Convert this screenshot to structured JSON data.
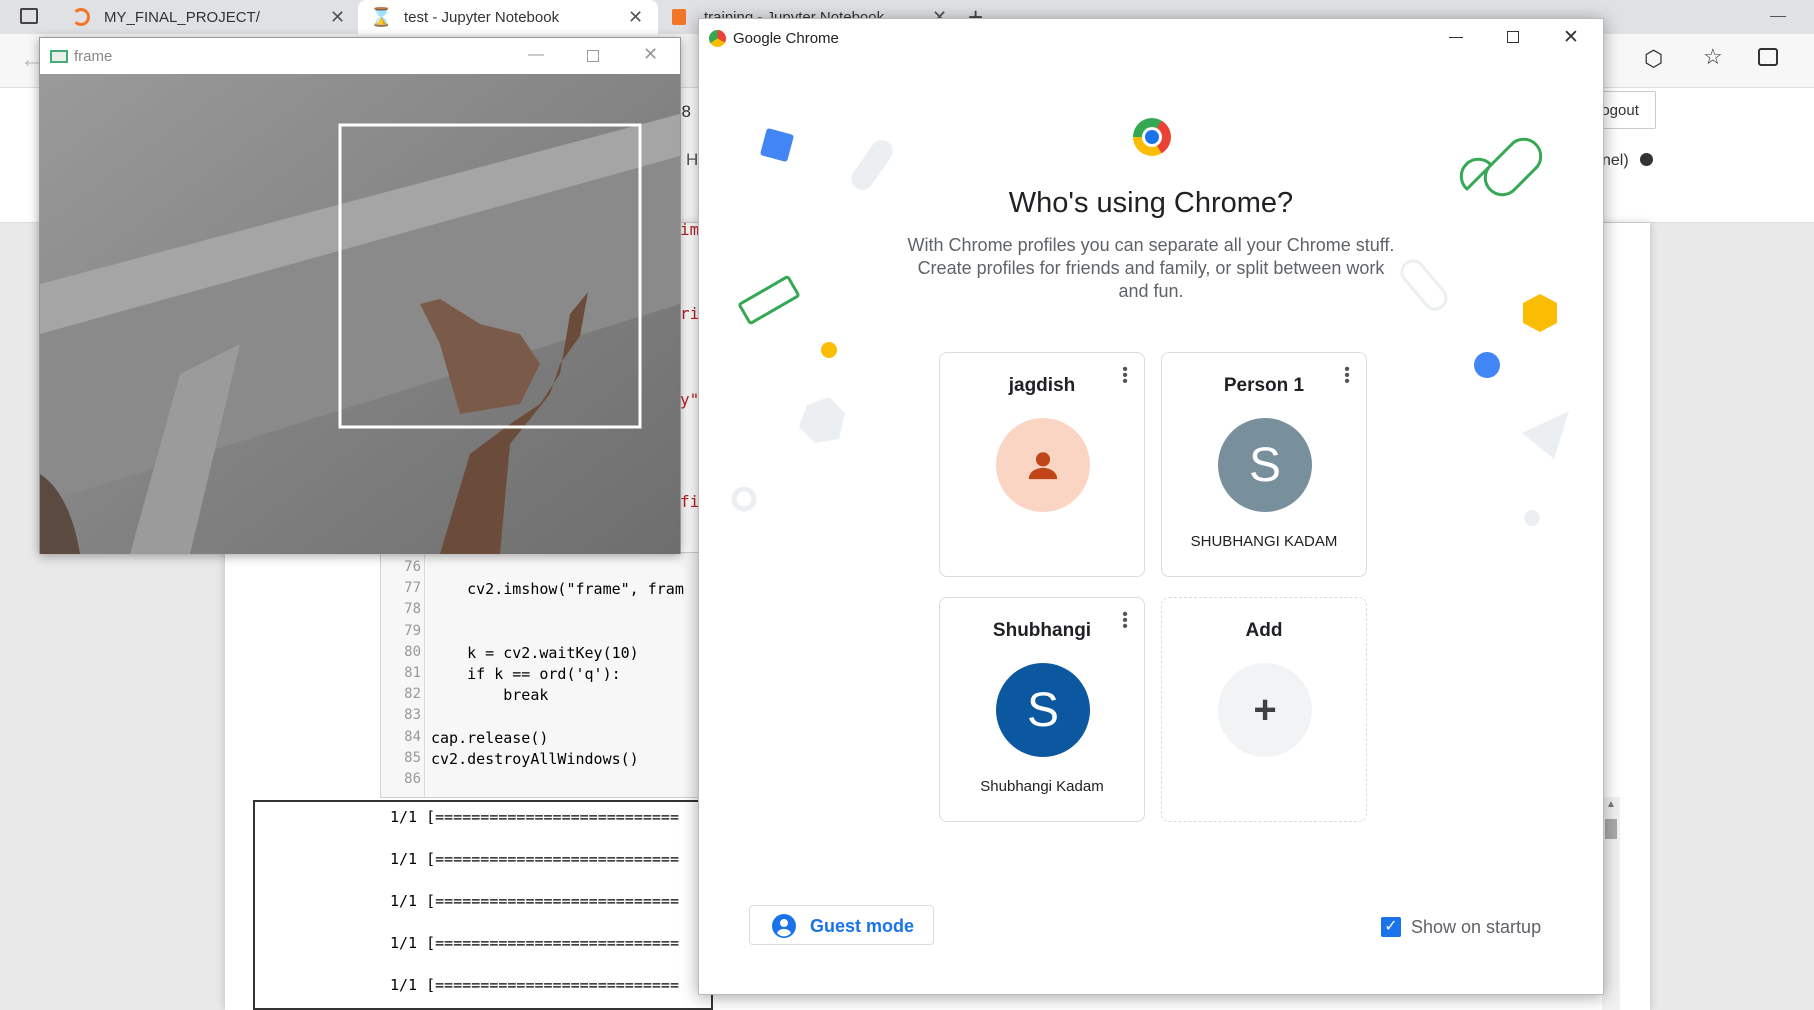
{
  "browser": {
    "tabs": [
      {
        "label": "MY_FINAL_PROJECT/"
      },
      {
        "label": "test - Jupyter Notebook"
      },
      {
        "label": "training - Jupyter Notebook"
      }
    ],
    "new_tab": "+",
    "logout_label": "Logout",
    "kernel_fragment": "nel)"
  },
  "notebook": {
    "code_lines": [
      {
        "num": "76",
        "code": ""
      },
      {
        "num": "77",
        "code": "    cv2.imshow(\"frame\", fram"
      },
      {
        "num": "78",
        "code": ""
      },
      {
        "num": "79",
        "code": ""
      },
      {
        "num": "80",
        "code": "    k = cv2.waitKey(10)"
      },
      {
        "num": "81",
        "code": "    if k == ord('q'):"
      },
      {
        "num": "82",
        "code": "        break"
      },
      {
        "num": "83",
        "code": ""
      },
      {
        "num": "84",
        "code": "cap.release()"
      },
      {
        "num": "85",
        "code": "cv2.destroyAllWindows()"
      },
      {
        "num": "86",
        "code": ""
      }
    ],
    "partial_fragments": [
      "t 8",
      "H",
      "im",
      "ri",
      "y\"",
      "fi"
    ],
    "output_lines": [
      "1/1 [===========================",
      "1/1 [===========================",
      "1/1 [===========================",
      "1/1 [===========================",
      "1/1 [==========================="
    ]
  },
  "frame_window": {
    "title": "frame"
  },
  "chrome_dialog": {
    "window_title": "Google Chrome",
    "heading": "Who's using Chrome?",
    "description": "With Chrome profiles you can separate all your Chrome stuff. Create profiles for friends and family, or split between work and fun.",
    "profiles": [
      {
        "name": "jagdish",
        "subtitle": "",
        "avatar_letter": "",
        "avatar_color": "#fbd5c4",
        "icon": "person-icon"
      },
      {
        "name": "Person 1",
        "subtitle": "SHUBHANGI KADAM",
        "avatar_letter": "S",
        "avatar_color": "#78909c"
      },
      {
        "name": "Shubhangi",
        "subtitle": "Shubhangi Kadam",
        "avatar_letter": "S",
        "avatar_color": "#0b57a0"
      }
    ],
    "add_card": {
      "label": "Add",
      "icon": "plus-icon"
    },
    "guest_mode_label": "Guest mode",
    "show_on_startup_label": "Show on startup",
    "show_on_startup_checked": true,
    "accent_color": "#1a73e8"
  }
}
